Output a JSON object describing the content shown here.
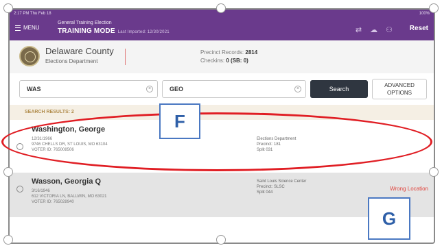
{
  "status_bar": {
    "time": "2:17 PM  Thu Feb 18",
    "battery": "100%"
  },
  "app_bar": {
    "menu_label": "MENU",
    "election_name": "General Training Election",
    "mode": "TRAINING MODE",
    "last_imported": "Last Imported: 12/30/2021",
    "reset_label": "Reset"
  },
  "county": {
    "name": "Delaware County",
    "department": "Elections Department",
    "precinct_records_label": "Precinct Records:",
    "precinct_records_value": "2814",
    "checkins_label": "Checkins:",
    "checkins_value": "0 (SB: 0)"
  },
  "search": {
    "last_name_value": "WAS",
    "first_name_value": "GEO",
    "search_button": "Search",
    "advanced_line1": "ADVANCED",
    "advanced_line2": "OPTIONS"
  },
  "results": {
    "label": "SEARCH RESULTS: 2",
    "voters": [
      {
        "name": "Washington, George",
        "dob": "12/31/1966",
        "address": "9746 CHELLS DR, ST LOUIS, MO 63104",
        "voter_id": "VOTER ID: 765008506",
        "location": "Elections Department",
        "precinct": "Precinct: 181",
        "split": "Split 031",
        "flag": ""
      },
      {
        "name": "Wasson, Georgia Q",
        "dob": "3/16/1946",
        "address": "612 VICTORIA LN, BALLWIN, MO 63021",
        "voter_id": "VOTER ID: 765028940",
        "location": "Saint Louis Science Center",
        "precinct": "Precinct: SLSC",
        "split": "Split 044",
        "flag": "Wrong Location"
      }
    ]
  },
  "annotations": {
    "label_f": "F",
    "label_g": "G",
    "ring_color": "#e01e24"
  }
}
